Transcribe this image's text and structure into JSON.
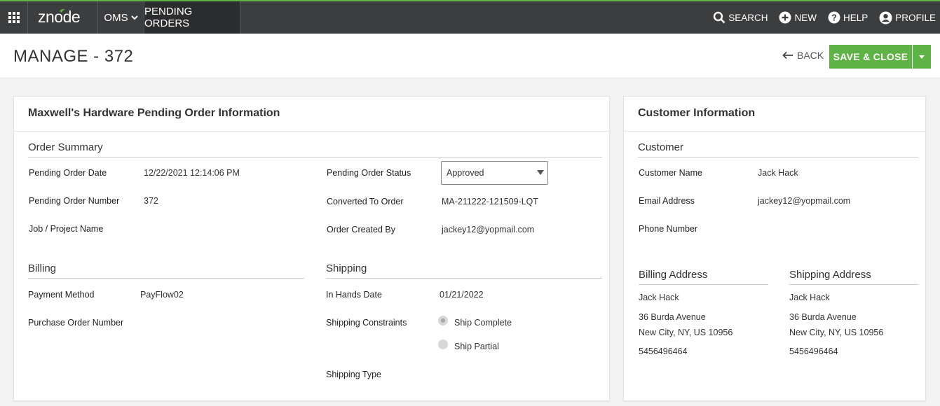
{
  "nav": {
    "logo_text": "znode",
    "oms_label": "OMS",
    "pending_orders_label": "PENDING ORDERS",
    "search_label": "SEARCH",
    "new_label": "NEW",
    "help_label": "HELP",
    "profile_label": "PROFILE"
  },
  "header": {
    "title": "MANAGE - 372",
    "back_label": "BACK",
    "save_close_label": "SAVE & CLOSE"
  },
  "order_panel": {
    "title": "Maxwell's Hardware Pending Order Information",
    "order_summary": {
      "title": "Order Summary",
      "pending_order_date_label": "Pending Order Date",
      "pending_order_date": "12/22/2021 12:14:06 PM",
      "pending_order_number_label": "Pending Order Number",
      "pending_order_number": "372",
      "job_project_name_label": "Job / Project Name",
      "pending_order_status_label": "Pending Order Status",
      "pending_order_status": "Approved",
      "converted_to_order_label": "Converted To Order",
      "converted_to_order": "MA-211222-121509-LQT",
      "order_created_by_label": "Order Created By",
      "order_created_by": "jackey12@yopmail.com"
    },
    "billing": {
      "title": "Billing",
      "payment_method_label": "Payment Method",
      "payment_method": "PayFlow02",
      "purchase_order_number_label": "Purchase Order Number"
    },
    "shipping": {
      "title": "Shipping",
      "in_hands_date_label": "In Hands Date",
      "in_hands_date": "01/21/2022",
      "shipping_constraints_label": "Shipping Constraints",
      "ship_complete_label": "Ship Complete",
      "ship_partial_label": "Ship Partial",
      "shipping_type_label": "Shipping Type"
    }
  },
  "customer_panel": {
    "title": "Customer Information",
    "customer": {
      "title": "Customer",
      "customer_name_label": "Customer Name",
      "customer_name": "Jack Hack",
      "email_label": "Email Address",
      "email": "jackey12@yopmail.com",
      "phone_label": "Phone Number"
    },
    "billing_address": {
      "title": "Billing Address",
      "name": "Jack Hack",
      "street": "36 Burda Avenue",
      "city_line": "New City, NY, US 10956",
      "phone": "5456496464"
    },
    "shipping_address": {
      "title": "Shipping Address",
      "name": "Jack Hack",
      "street": "36 Burda Avenue",
      "city_line": "New City, NY, US 10956",
      "phone": "5456496464"
    }
  },
  "colors": {
    "accent": "#5fb246",
    "topbar": "#3c3d3f",
    "active_nav": "#2b2c2e"
  }
}
